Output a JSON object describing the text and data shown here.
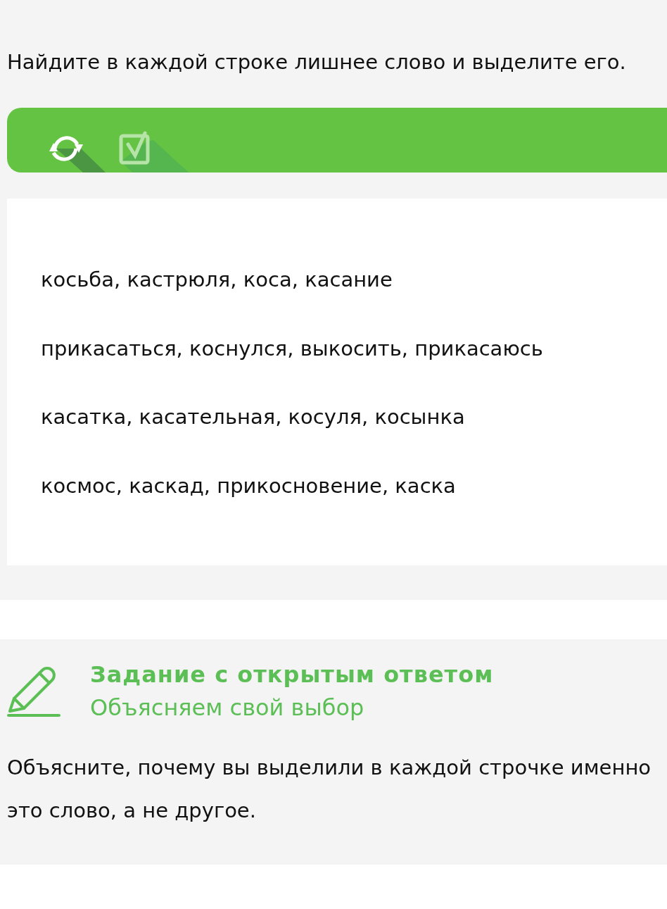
{
  "task": {
    "instruction": "Найдите в каждой строке лишнее слово и выделите его.",
    "toolbar": [
      {
        "kind": "reset",
        "disabled": false
      },
      {
        "kind": "check",
        "disabled": true
      }
    ],
    "rows": [
      "косьба, кастрюля, коса, касание",
      "прикасаться, коснулся, выкосить, прикасаюсь",
      "касатка, касательная, косуля, косынка",
      "космос, каскад, прикосновение, каска"
    ]
  },
  "open_task": {
    "title": "Задание с открытым ответом",
    "subtitle": "Объясняем свой выбор",
    "instruction": "Объясните, почему вы выделили в каждой строчке именно это слово, а не другое."
  }
}
